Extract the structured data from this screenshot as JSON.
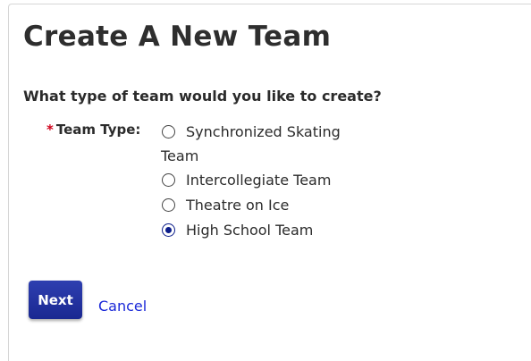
{
  "page": {
    "title": "Create A New Team",
    "question": "What type of team would you like to create?"
  },
  "form": {
    "required_marker": "*",
    "field_label": "Team Type:",
    "options": [
      {
        "label": "Synchronized Skating Team",
        "selected": false
      },
      {
        "label": "Intercollegiate Team",
        "selected": false
      },
      {
        "label": "Theatre on Ice",
        "selected": false
      },
      {
        "label": "High School Team",
        "selected": true
      }
    ]
  },
  "actions": {
    "next_label": "Next",
    "cancel_label": "Cancel"
  },
  "colors": {
    "accent": "#1a2891",
    "link": "#1a28d8",
    "required": "#d0021b"
  }
}
